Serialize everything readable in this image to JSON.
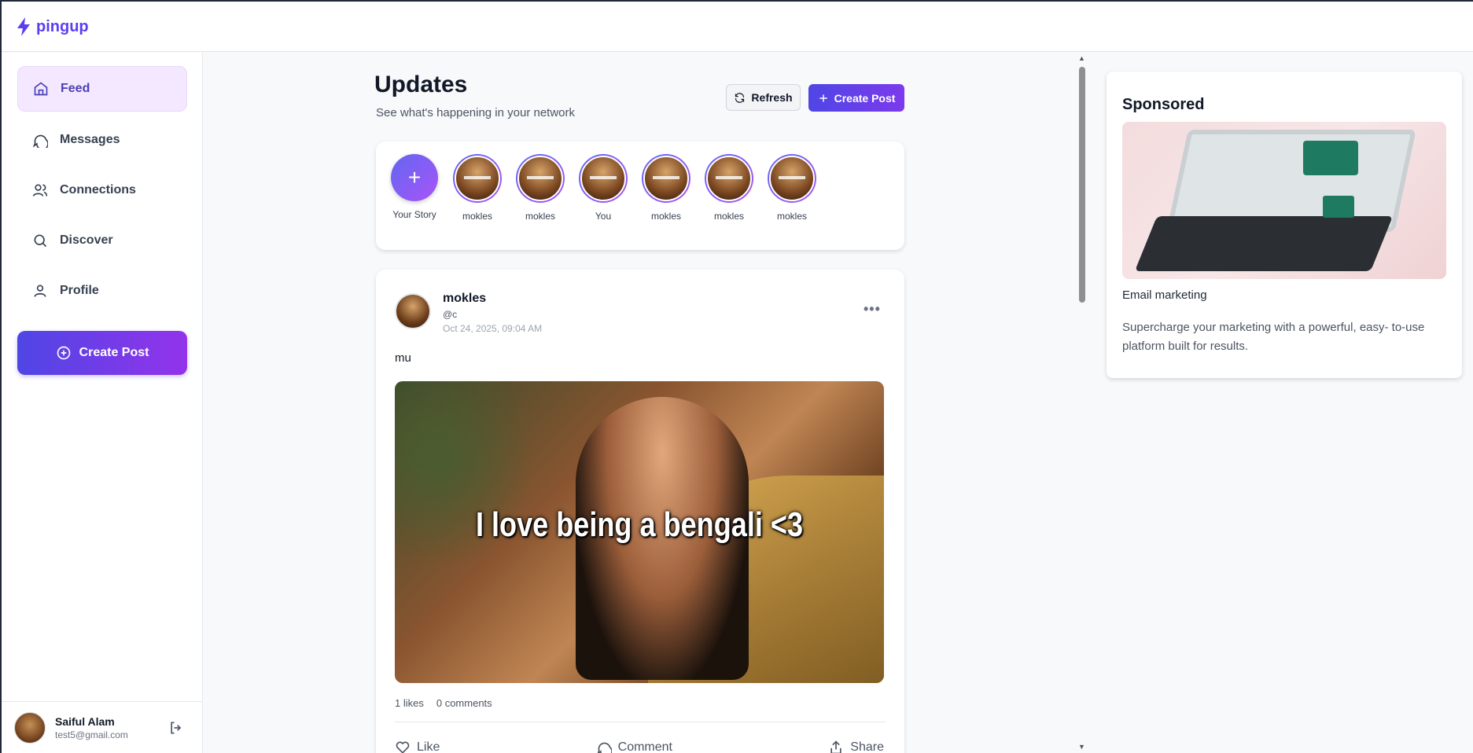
{
  "app": {
    "name": "pingup",
    "brand_color": "#5b3df5"
  },
  "sidebar": {
    "items": [
      {
        "label": "Feed",
        "icon": "home-icon",
        "active": true
      },
      {
        "label": "Messages",
        "icon": "message-icon",
        "active": false
      },
      {
        "label": "Connections",
        "icon": "users-icon",
        "active": false
      },
      {
        "label": "Discover",
        "icon": "search-icon",
        "active": false
      },
      {
        "label": "Profile",
        "icon": "user-icon",
        "active": false
      }
    ],
    "create_post_label": "Create Post",
    "user": {
      "name": "Saiful Alam",
      "email": "test5@gmail.com"
    }
  },
  "feed": {
    "title": "Updates",
    "subtitle": "See what's happening in your network",
    "refresh_label": "Refresh",
    "create_post_label": "Create Post",
    "stories": [
      {
        "label": "Your Story",
        "type": "add"
      },
      {
        "label": "mokles"
      },
      {
        "label": "mokles"
      },
      {
        "label": "You"
      },
      {
        "label": "mokles"
      },
      {
        "label": "mokles"
      },
      {
        "label": "mokles"
      }
    ],
    "post": {
      "author": "mokles",
      "handle": "@c",
      "timestamp": "Oct 24, 2025, 09:04 AM",
      "text": "mu",
      "image_caption": "I love being a bengali <3",
      "likes": "1 likes",
      "comments": "0 comments",
      "actions": {
        "like": "Like",
        "comment": "Comment",
        "share": "Share"
      }
    }
  },
  "sponsored": {
    "heading": "Sponsored",
    "name": "Email marketing",
    "description": "Supercharge your marketing with a powerful, easy- to-use platform built for results."
  }
}
